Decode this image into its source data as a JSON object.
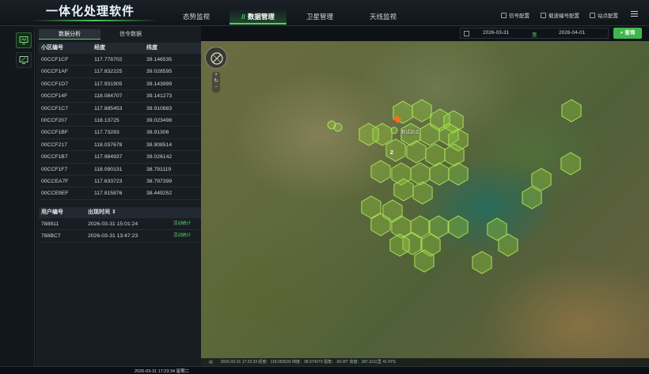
{
  "app": {
    "title": "一体化处理软件"
  },
  "nav": {
    "tabs": [
      {
        "label": "态势监视",
        "active": false
      },
      {
        "label": "数据管理",
        "active": true
      },
      {
        "label": "卫星管理",
        "active": false
      },
      {
        "label": "天线监视",
        "active": false
      }
    ]
  },
  "toolbar": {
    "items": [
      {
        "label": "信号配置",
        "icon": "signal-icon"
      },
      {
        "label": "载波编号配置",
        "icon": "grid-icon"
      },
      {
        "label": "站点配置",
        "icon": "station-icon"
      }
    ],
    "menu_icon": "menu-icon"
  },
  "subtabs": [
    {
      "label": "数据分析",
      "active": true
    },
    {
      "label": "信令数据",
      "active": false
    }
  ],
  "cells_table": {
    "columns": [
      "小区编号",
      "经度",
      "纬度"
    ],
    "rows": [
      [
        "00CCF1CF",
        "117.778702",
        "39.146535"
      ],
      [
        "00CCF1AF",
        "117.832225",
        "39.028595"
      ],
      [
        "00CCF1D7",
        "117.931905",
        "39.143999"
      ],
      [
        "00CCF14F",
        "118.084707",
        "39.141273"
      ],
      [
        "00CCF1C7",
        "117.885453",
        "38.910883"
      ],
      [
        "00CCF207",
        "118.13725",
        "39.023498"
      ],
      [
        "00CCF1BF",
        "117.73283",
        "38.91306"
      ],
      [
        "00CCF217",
        "118.037678",
        "38.908514"
      ],
      [
        "00CCF1B7",
        "117.984937",
        "39.026142"
      ],
      [
        "00CCF1F7",
        "118.090131",
        "38.791119"
      ],
      [
        "00CCEA7F",
        "117.633723",
        "38.797399"
      ],
      [
        "00CCE9EF",
        "117.815876",
        "38.449252"
      ]
    ]
  },
  "users_table": {
    "columns": [
      "用户编号",
      "出现时间"
    ],
    "sort_icon": "sort-icon",
    "rows": [
      {
        "id": "788811",
        "time": "2026-03-31 15:01:24",
        "action": "活动统计"
      },
      {
        "id": "788BC7",
        "time": "2026-03-31 13:47:23",
        "action": "活动统计"
      }
    ]
  },
  "date_range": {
    "start": "2026-03-31",
    "separator": "至",
    "end": "2026-04-01"
  },
  "query_button": "查询",
  "map": {
    "pin_label": "测试站点",
    "cluster_count": "2",
    "colors": {
      "hex_fill": "rgba(150,210,60,0.35)",
      "hex_stroke": "#a8e05a",
      "pin": "#ff6a1a"
    }
  },
  "statusbar": {
    "text": "2026-03-31 17:23:33  经度：118.093639  纬度：38.974373  视角：-90.00°  高度：287.32公里  41 FPS"
  },
  "footer": {
    "text": "2026-03-31  17:23:34  星期二"
  }
}
